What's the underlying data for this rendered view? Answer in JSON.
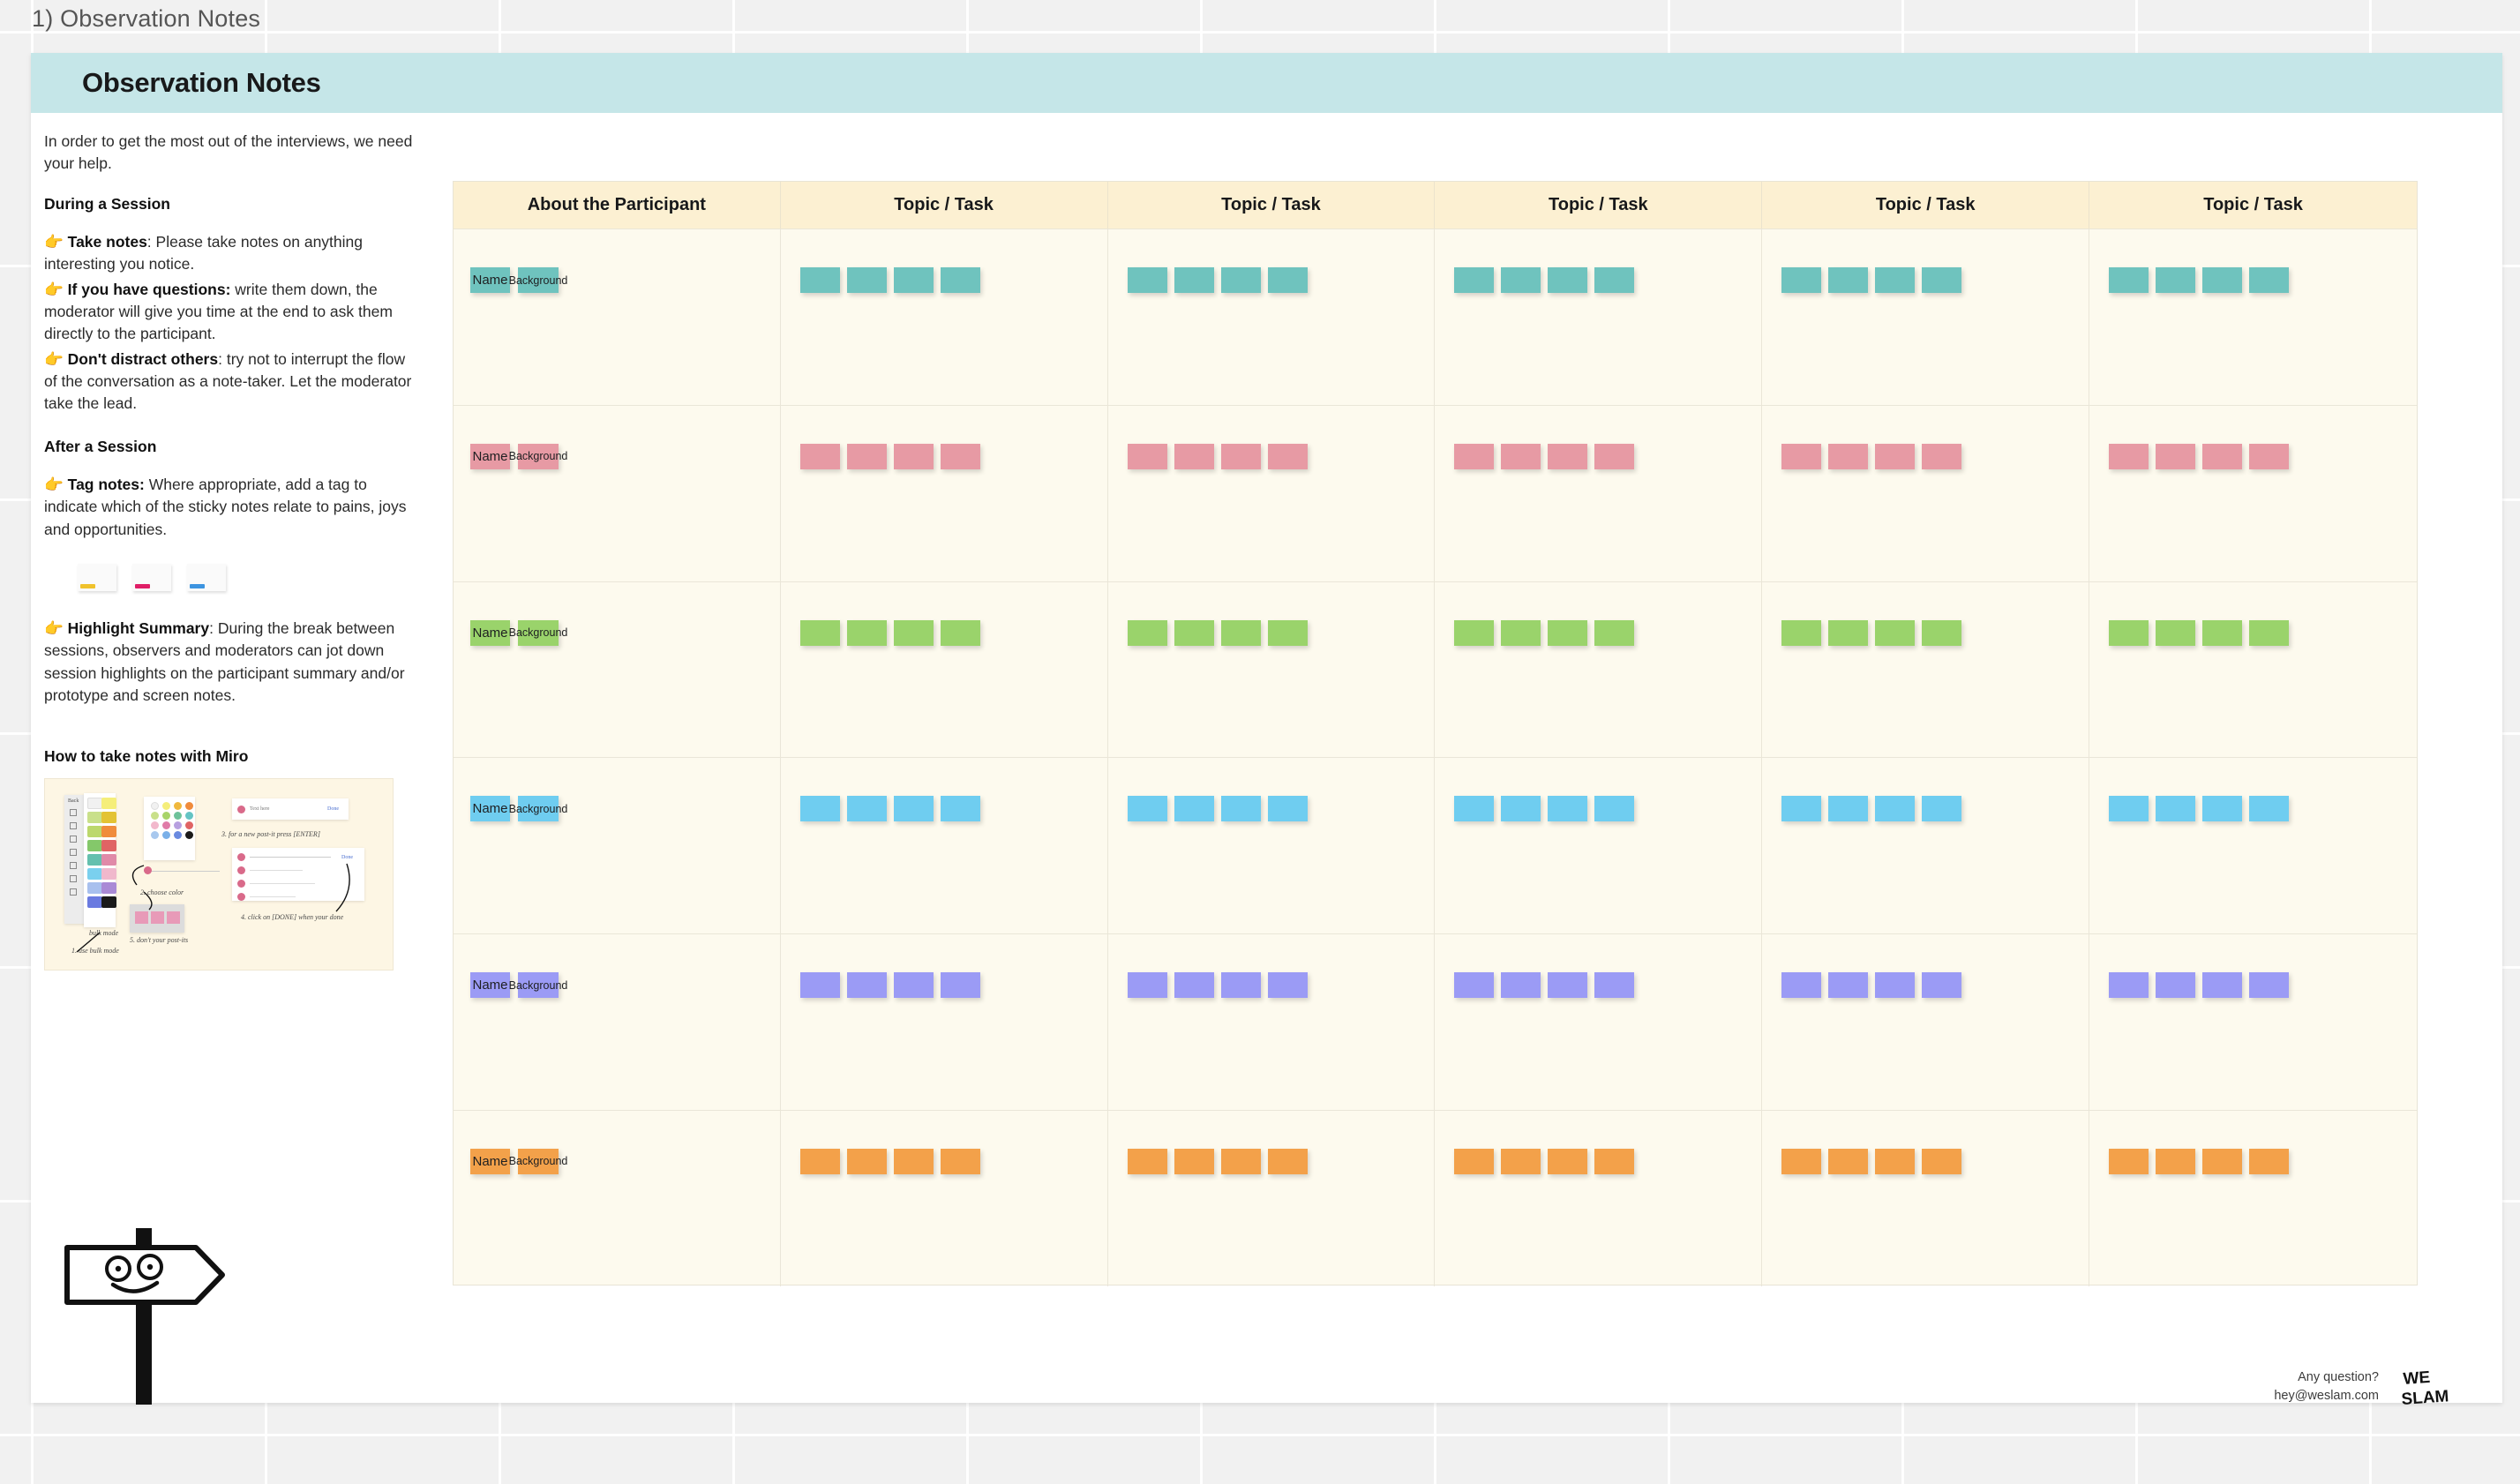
{
  "board": {
    "label": "1) Observation Notes",
    "canvas_color": "#f1f1f1"
  },
  "frame": {
    "title": "Observation Notes",
    "header_color": "#c5e6e8",
    "background": "#ffffff"
  },
  "left_panel": {
    "intro": "In order to get the most out of the interviews, we need your help.",
    "during_session": {
      "heading": "During a Session",
      "items": [
        {
          "hand": "👉",
          "bold": "Take notes",
          "rest": ": Please take notes on anything interesting you notice."
        },
        {
          "hand": "👉",
          "bold": "If you have questions:",
          "rest": " write them down, the moderator will give you time at the end to ask them directly to the participant."
        },
        {
          "hand": "👉",
          "bold": "Don't distract others",
          "rest": ": try not to interrupt the flow of the conversation as a note-taker. Let the moderator take the lead."
        }
      ]
    },
    "after_session": {
      "heading": "After a Session",
      "tag_item": {
        "hand": "👉",
        "bold": "Tag notes:",
        "rest": " Where appropriate, add a tag to indicate which of the sticky notes relate to pains, joys and opportunities."
      },
      "tag_colors": [
        "#f0c22c",
        "#e01e67",
        "#3d94e0"
      ],
      "highlight_item": {
        "hand": "👉",
        "bold": "Highlight Summary",
        "rest": ": During the break between sessions, observers and moderators can jot down session highlights on the participant summary and/or prototype and screen notes."
      }
    },
    "miro": {
      "heading": "How to take notes with Miro",
      "steps": [
        "1. use bulk mode",
        "2. choose color",
        "3. for a new post-it press [ENTER]",
        "4. click on [DONE] when your done",
        "5. don't your post-its"
      ],
      "palette": [
        "#f1f1f1",
        "#f5ee7a",
        "#f0b83c",
        "#f08c3c",
        "#c9e08a",
        "#a8d46a",
        "#6ec29a",
        "#64c4c4",
        "#f2b8cc",
        "#e07ba8",
        "#b8a0e0",
        "#e06464",
        "#a8c8ee",
        "#7ab0e8",
        "#6a8ae0",
        "#1a1a1a"
      ],
      "bulk_label": "bulk mode",
      "panel_label": "Back"
    }
  },
  "table": {
    "columns": [
      {
        "label": "About the Participant",
        "type": "participant"
      },
      {
        "label": "Topic / Task",
        "type": "task"
      },
      {
        "label": "Topic / Task",
        "type": "task"
      },
      {
        "label": "Topic / Task",
        "type": "task"
      },
      {
        "label": "Topic / Task",
        "type": "task"
      },
      {
        "label": "Topic / Task",
        "type": "task"
      }
    ],
    "header_bg": "#fcf0d2",
    "body_bg": "#fdfaee",
    "participant_note_labels": [
      "Name",
      "Background"
    ],
    "task_notes_per_cell": 4,
    "rows": [
      {
        "index": 1,
        "color": "#6fc3be"
      },
      {
        "index": 2,
        "color": "#e79aa4"
      },
      {
        "index": 3,
        "color": "#9ad36b"
      },
      {
        "index": 4,
        "color": "#6fcdf0"
      },
      {
        "index": 5,
        "color": "#9b9bf5"
      },
      {
        "index": 6,
        "color": "#f3a14a"
      }
    ]
  },
  "footer": {
    "question": "Any question?",
    "email": "hey@weslam.com",
    "logo_line1": "WE",
    "logo_line2": "SLAM"
  }
}
